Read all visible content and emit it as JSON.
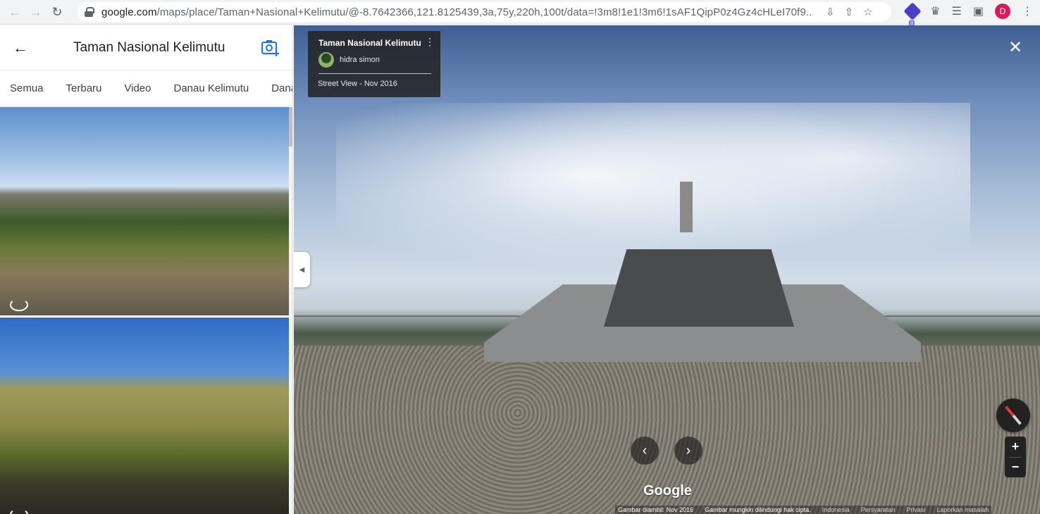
{
  "browser": {
    "url_host": "google.com",
    "url_rest": "/maps/place/Taman+Nasional+Kelimutu/@-8.7642366,121.8125439,3a,75y,220h,100t/data=!3m8!1e1!3m6!1sAF1QipP0z4Gz4cHLeI70f9...",
    "extension_badge": "8",
    "profile_initial": "D"
  },
  "panel": {
    "title": "Taman Nasional Kelimutu",
    "tabs": [
      "Semua",
      "Terbaru",
      "Video",
      "Danau Kelimutu",
      "Dana"
    ]
  },
  "streetview": {
    "card_title": "Taman Nasional Kelimutu",
    "author": "hidra simon",
    "date": "Street View - Nov 2016",
    "logo": "Google",
    "footer": {
      "captured": "Gambar diambil: Nov 2016",
      "copyright": "Gambar mungkin dilindungi hak cipta.",
      "language": "Indonesia",
      "terms": "Persyaratan",
      "privacy": "Privasi",
      "report": "Laporkan masalah"
    }
  },
  "colors": {
    "accent": "#1a73e8",
    "chrome_bg": "#f1f3f4",
    "profile": "#d81b60"
  }
}
